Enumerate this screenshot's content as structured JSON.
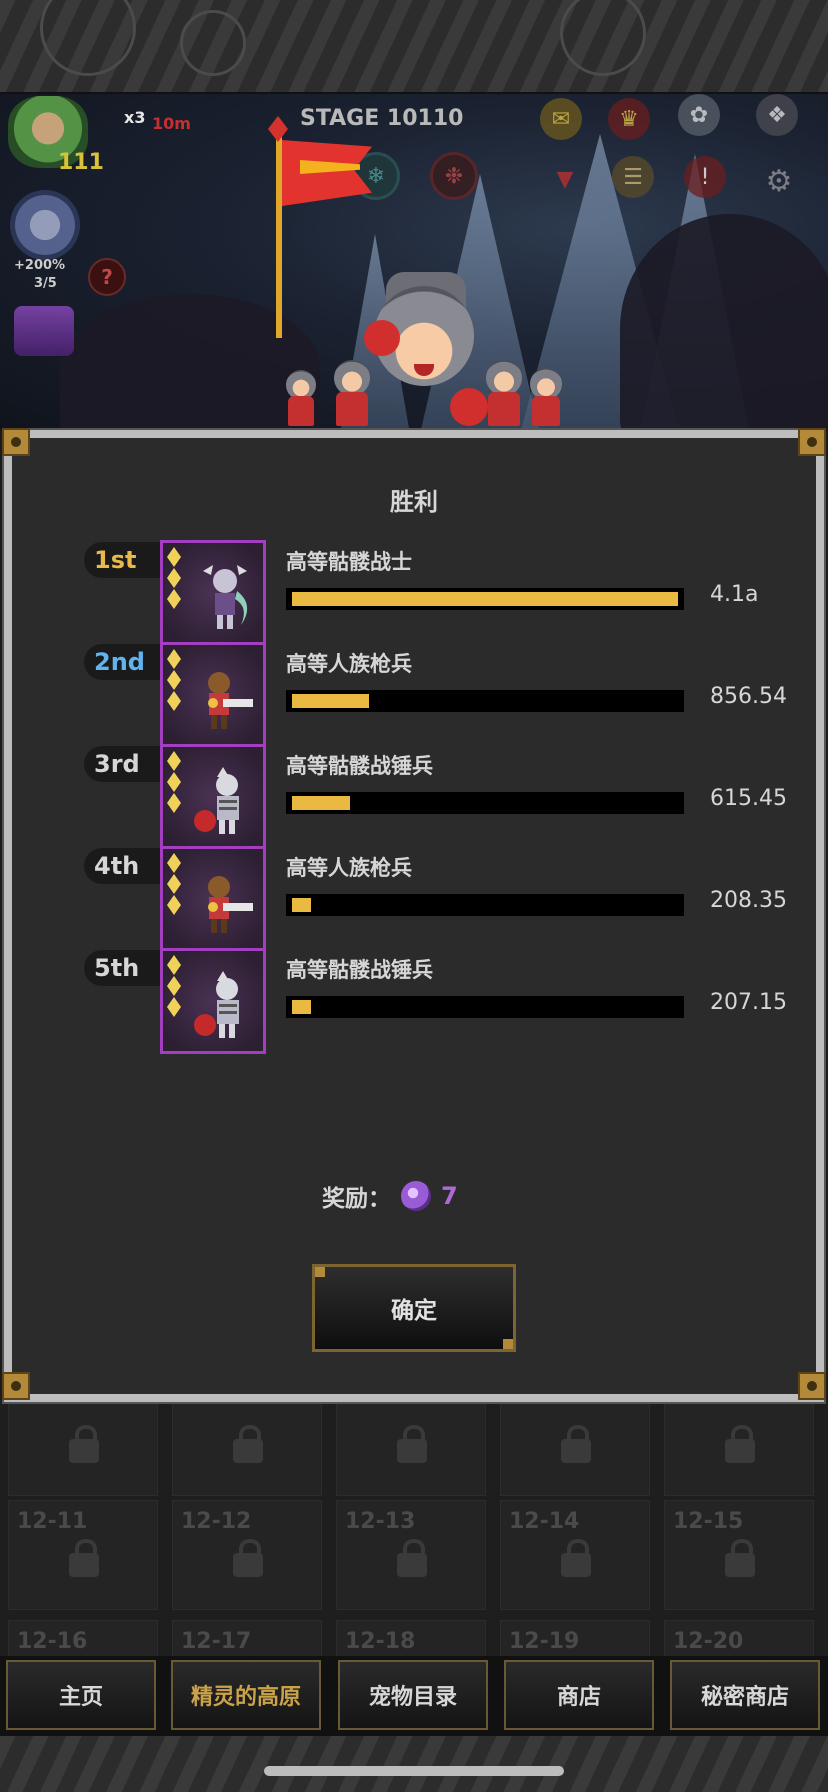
{
  "hud": {
    "stage": "STAGE 10110",
    "speed": "x3",
    "timer": "10m",
    "level": "111",
    "bonus_percent": "+200%",
    "bonus_fraction": "3/5",
    "help_glyph": "?"
  },
  "modal": {
    "title": "胜利",
    "rankings": [
      {
        "rank": "1st",
        "rank_color": "#e8b94a",
        "name": "高等骷髅战士",
        "value": "4.1a",
        "fill": 1.0,
        "sprite": "skeleton-warrior"
      },
      {
        "rank": "2nd",
        "rank_color": "#5fb4f0",
        "name": "高等人族枪兵",
        "value": "856.54",
        "fill": 0.2,
        "sprite": "human-gunner"
      },
      {
        "rank": "3rd",
        "rank_color": "#d6d6d6",
        "name": "高等骷髅战锤兵",
        "value": "615.45",
        "fill": 0.15,
        "sprite": "skeleton-hammer"
      },
      {
        "rank": "4th",
        "rank_color": "#d6d6d6",
        "name": "高等人族枪兵",
        "value": "208.35",
        "fill": 0.05,
        "sprite": "human-gunner"
      },
      {
        "rank": "5th",
        "rank_color": "#d6d6d6",
        "name": "高等骷髅战锤兵",
        "value": "207.15",
        "fill": 0.05,
        "sprite": "skeleton-hammer"
      }
    ],
    "reward_label": "奖励：",
    "reward_value": "7",
    "confirm_label": "确定"
  },
  "stage_tiles": {
    "rows": [
      [
        "",
        "",
        "",
        "",
        ""
      ],
      [
        "12-11",
        "12-12",
        "12-13",
        "12-14",
        "12-15"
      ],
      [
        "12-16",
        "12-17",
        "12-18",
        "12-19",
        "12-20"
      ]
    ]
  },
  "nav": {
    "items": [
      {
        "label": "主页",
        "active": false
      },
      {
        "label": "精灵的高原",
        "active": true
      },
      {
        "label": "宠物目录",
        "active": false
      },
      {
        "label": "商店",
        "active": false
      },
      {
        "label": "秘密商店",
        "active": false
      }
    ]
  },
  "colors": {
    "bar_fill": "#eab942",
    "portrait_border": "#a33ec0",
    "gold_trim": "#b28a3a"
  }
}
